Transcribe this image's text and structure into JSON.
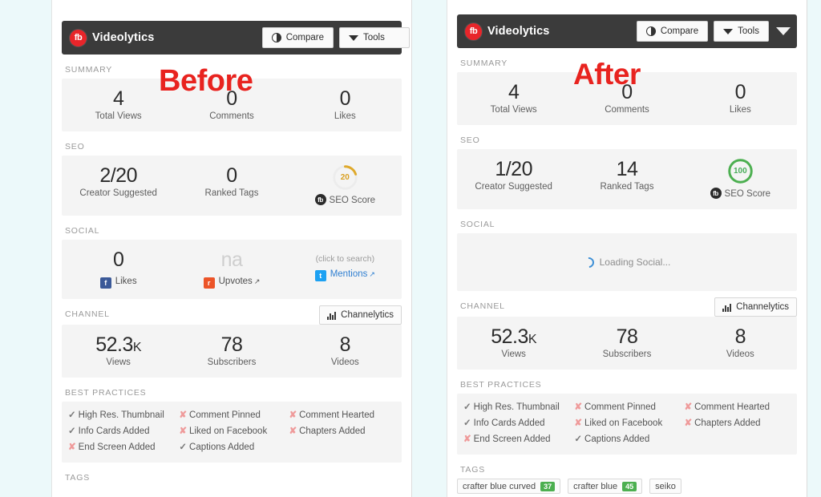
{
  "app": {
    "brand_name": "Videolytics",
    "brand_logo_text": "fb",
    "compare_label": "Compare",
    "tools_label": "Tools",
    "accent_red": "#e8252a",
    "bar_color": "#3b3b3b"
  },
  "stamps": {
    "before": "Before",
    "after": "After"
  },
  "sections": {
    "summary_label": "SUMMARY",
    "seo_label": "SEO",
    "social_label": "SOCIAL",
    "channel_label": "CHANNEL",
    "best_practices_label": "BEST PRACTICES",
    "tags_label": "TAGS"
  },
  "common": {
    "channelytics_label": "Channelytics",
    "seo_score_label": "SEO Score",
    "summary_labels": [
      "Total Views",
      "Comments",
      "Likes"
    ],
    "seo_labels": [
      "Creator Suggested",
      "Ranked Tags"
    ],
    "channel_labels": [
      "Views",
      "Subscribers",
      "Videos"
    ],
    "best_practices": [
      {
        "label": "High Res. Thumbnail",
        "state": "check"
      },
      {
        "label": "Comment Pinned",
        "state": "cross"
      },
      {
        "label": "Comment Hearted",
        "state": "cross"
      },
      {
        "label": "Info Cards Added",
        "state": "check"
      },
      {
        "label": "Liked on Facebook",
        "state": "cross"
      },
      {
        "label": "Chapters Added",
        "state": "cross"
      },
      {
        "label": "End Screen Added",
        "state": "cross"
      },
      {
        "label": "Captions Added",
        "state": "check"
      }
    ],
    "check_glyph": "✓",
    "cross_glyph": "✘"
  },
  "before": {
    "summary_values": [
      "4",
      "0",
      "0"
    ],
    "seo_creator_suggested": "2/20",
    "seo_ranked_tags": "0",
    "seo_score": "20",
    "seo_score_color": "#dfa92b",
    "seo_score_progress": 20,
    "social": {
      "likes_value": "0",
      "likes_label": "Likes",
      "upvotes_value": "na",
      "upvotes_label": "Upvotes",
      "mentions_value": "(click to search)",
      "mentions_label": "Mentions"
    },
    "channel_views": "52.3",
    "channel_views_unit": "K",
    "channel_subscribers": "78",
    "channel_videos": "8"
  },
  "after": {
    "summary_values": [
      "4",
      "0",
      "0"
    ],
    "seo_creator_suggested": "1/20",
    "seo_ranked_tags": "14",
    "seo_score": "100",
    "seo_score_color": "#4caf50",
    "seo_score_progress": 100,
    "social_loading_text": "Loading Social...",
    "channel_views": "52.3",
    "channel_views_unit": "K",
    "channel_subscribers": "78",
    "channel_videos": "8",
    "tags": [
      {
        "text": "crafter blue curved",
        "badge": "37"
      },
      {
        "text": "crafter blue",
        "badge": "45"
      },
      {
        "text": "seiko",
        "badge": ""
      }
    ]
  }
}
